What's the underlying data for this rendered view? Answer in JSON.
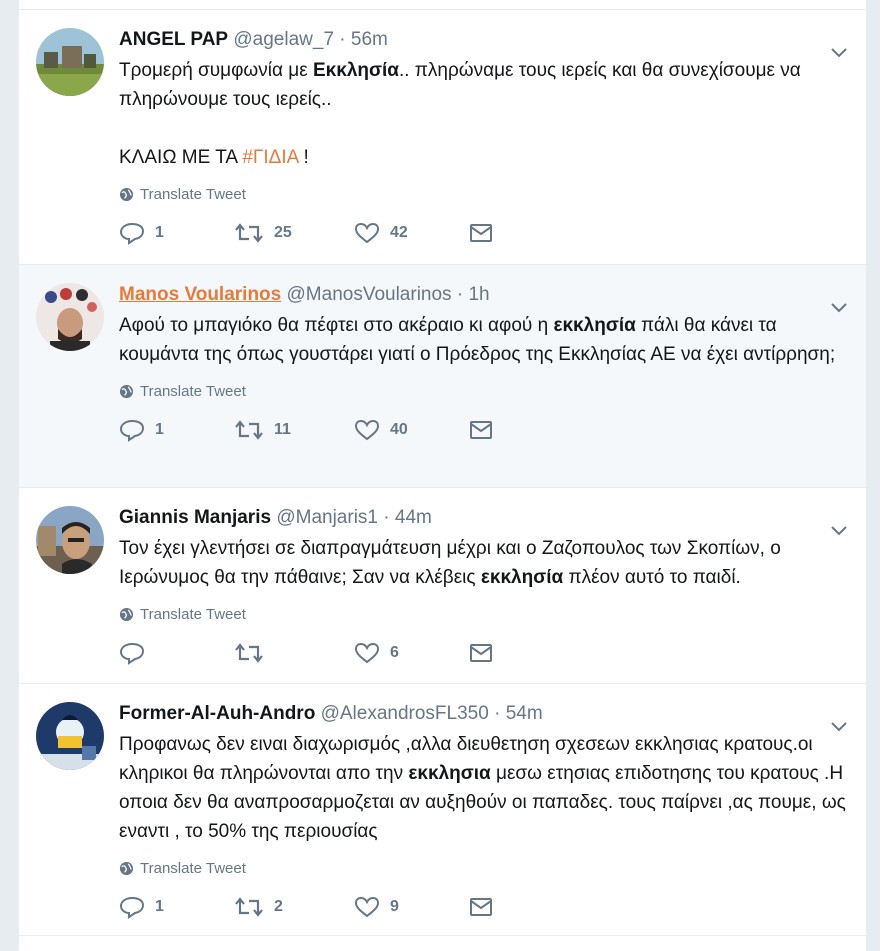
{
  "ui": {
    "translate_label": "Translate Tweet"
  },
  "tweets": [
    {
      "name": "ANGEL PAP",
      "handle": "@agelaw_7",
      "sep": "·",
      "time": "56m",
      "text_1": "Τρομερή συμφωνία με ",
      "text_bold_1": "Εκκλησία",
      "text_2": ".. πληρώναμε τους ιερείς και θα συνεχίσουμε να πληρώνουμε τους ιερείς..",
      "text_3": "ΚΛΑΙΩ ΜΕ ΤΑ ",
      "hashtag": "#ΓΙΔΙΑ",
      "text_4": " !",
      "replies": "1",
      "retweets": "25",
      "likes": "42"
    },
    {
      "name": "Manos Voularinos",
      "handle": "@ManosVoularinos",
      "sep": "·",
      "time": "1h",
      "text_1": "Αφού το μπαγιόκο θα πέφτει στο ακέραιο κι αφού η ",
      "text_bold_1": "εκκλησία",
      "text_2": " πάλι θα κάνει τα κουμάντα της όπως γουστάρει γιατί ο Πρόεδρος της Εκκλησίας ΑΕ να έχει αντίρρηση;",
      "replies": "1",
      "retweets": "11",
      "likes": "40"
    },
    {
      "name": "Giannis Manjaris",
      "handle": "@Manjaris1",
      "sep": "·",
      "time": "44m",
      "text_1": "Τον έχει γλεντήσει σε διαπραγμάτευση μέχρι και ο Ζαζοπουλος των Σκοπίων, ο Ιερώνυμος θα την πάθαινε; Σαν να κλέβεις ",
      "text_bold_1": "εκκλησία",
      "text_2": " πλέον αυτό το παιδί.",
      "replies": "",
      "retweets": "",
      "likes": "6"
    },
    {
      "name": "Former-Al-Auh-Andro",
      "handle": "@AlexandrosFL350",
      "sep": "·",
      "time": "54m",
      "text_1": "Προφανως δεν ειναι διαχωρισμός ,αλλα διευθετηση σχεσεων εκκλησιας κρατους.οι κληρικοι θα πληρώνονται απο την ",
      "text_bold_1": "εκκλησια",
      "text_2": " μεσω ετησιας επιδοτησης του κρατους .Η οποια δεν θα αναπροσαρμοζεται αν αυξηθούν οι παπαδες.  τους παίρνει ,ας πουμε, ως εναντι , το 50% της περιουσίας",
      "replies": "1",
      "retweets": "2",
      "likes": "9"
    }
  ]
}
